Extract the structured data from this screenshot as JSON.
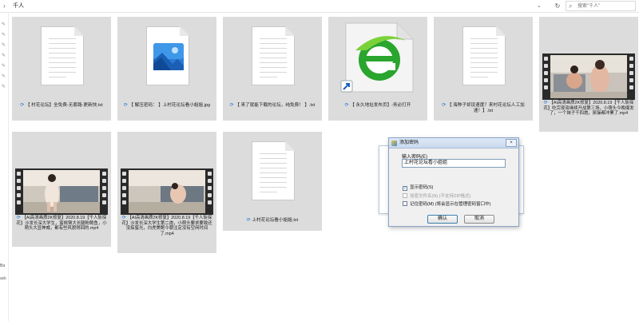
{
  "topbar": {
    "breadcrumb": "千人",
    "search_placeholder": "搜索\"千人\"",
    "nav_chevron_icon": "chevron-right-icon",
    "dropdown_icon": "chevron-down-icon",
    "refresh_icon": "refresh-icon",
    "search_icon": "search-icon"
  },
  "leftnav": {
    "labels": [
      "Ba",
      "ack"
    ]
  },
  "files": [
    {
      "type": "txt",
      "name": "【 村花论坛】全免费-无套路-更新快.txt"
    },
    {
      "type": "jpg",
      "name": "【 解压密码： 】上村花论坛看小姐姐.jpg"
    },
    {
      "type": "txt",
      "name": "【 来了就能下载的论坛，纯免费！ 】.txt"
    },
    {
      "type": "url",
      "name": "【 永久地址发布页】-务必打开"
    },
    {
      "type": "txt",
      "name": "【 海种子却设速度？来村花论坛人工加速！】.txt"
    },
    {
      "type": "mp4",
      "name": "【AI高清画质2K修复】2020.8.19【千人斩探花】吃完夜宵继续开战第三场，小萌头今晚爆发了，一个妹子干四炮，屌操都冲累了.mp4"
    },
    {
      "type": "mp4",
      "name": "【AI高清画质2K修复】2020.8.19【千人斩探花】沙发长深大学生，蜜桃臀大长腿粉鲍鱼，小萌头大显神威，都有些风貌得回的.mp4"
    },
    {
      "type": "mp4",
      "name": "【AI高清画质2K修复】2020.8.19【千人斩探花】沙发长深大学生第二炮，小萌头要求要致还没搞蜜光，白虎美鲍今朝注定没有空闲时间了.mp4"
    },
    {
      "type": "txt",
      "name": "上村花论坛看小姐姐.txt"
    }
  ],
  "dialog": {
    "title": "添加密码",
    "close_label": "×",
    "password_label": "输入密码(E)",
    "password_value": "上村花论坛看小姐姐",
    "show_password": "显示密码(S)",
    "encrypt_filenames": "加密文件名(N) (不支持ZIP格式)",
    "remember_password": "记住密码(M) (将会显示在管理密码窗口中)",
    "ok_label": "确认",
    "cancel_label": "取消",
    "show_password_checked": true
  },
  "statusbar": {
    "items": [
      "",
      ""
    ]
  }
}
